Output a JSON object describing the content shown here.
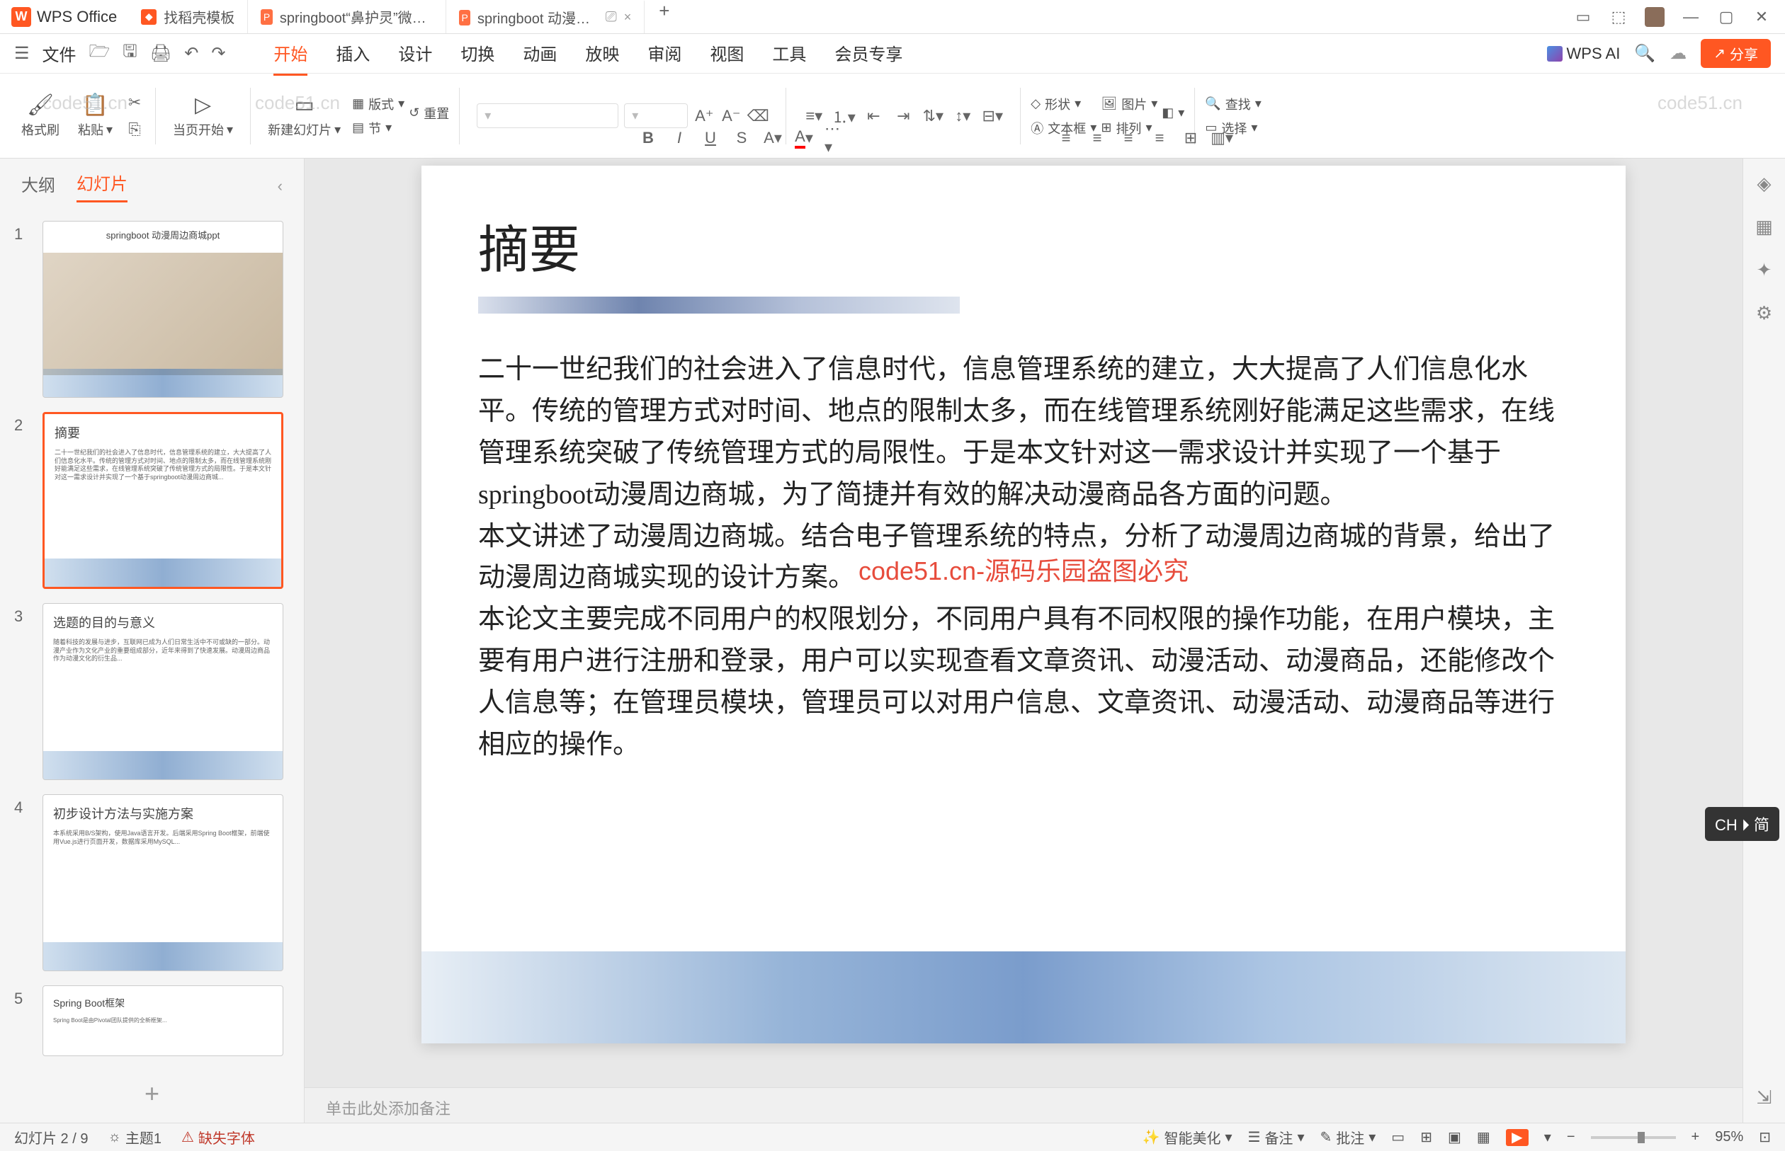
{
  "app_name": "WPS Office",
  "tabs": [
    {
      "icon": "red",
      "label": "找稻壳模板"
    },
    {
      "icon": "orange",
      "label": "springboot“鼻护灵”微信小程序的"
    },
    {
      "icon": "orange",
      "label": "springboot 动漫周边商城的",
      "active": true
    }
  ],
  "file_menu": "文件",
  "menu_tabs": [
    "开始",
    "插入",
    "设计",
    "切换",
    "动画",
    "放映",
    "审阅",
    "视图",
    "工具",
    "会员专享"
  ],
  "active_menu_tab": "开始",
  "wps_ai_label": "WPS AI",
  "share_label": "分享",
  "ribbon": {
    "format_brush": "格式刷",
    "paste": "粘贴",
    "from_current": "当页开始",
    "new_slide": "新建幻灯片",
    "layout": "版式",
    "section": "节",
    "reset": "重置",
    "shape": "形状",
    "textbox": "文本框",
    "image": "图片",
    "arrange": "排列",
    "find": "查找",
    "select": "选择"
  },
  "sidebar": {
    "outline_tab": "大纲",
    "slides_tab": "幻灯片",
    "thumbs": [
      {
        "num": "1",
        "title": "springboot 动漫周边商城ppt"
      },
      {
        "num": "2",
        "title": "摘要",
        "active": true
      },
      {
        "num": "3",
        "title": "选题的目的与意义"
      },
      {
        "num": "4",
        "title": "初步设计方法与实施方案"
      },
      {
        "num": "5",
        "title": "Spring Boot框架"
      }
    ]
  },
  "slide": {
    "title": "摘要",
    "body": "二十一世纪我们的社会进入了信息时代，信息管理系统的建立，大大提高了人们信息化水平。传统的管理方式对时间、地点的限制太多，而在线管理系统刚好能满足这些需求，在线管理系统突破了传统管理方式的局限性。于是本文针对这一需求设计并实现了一个基于springboot动漫周边商城，为了简捷并有效的解决动漫商品各方面的问题。\n本文讲述了动漫周边商城。结合电子管理系统的特点，分析了动漫周边商城的背景，给出了动漫周边商城实现的设计方案。\n本论文主要完成不同用户的权限划分，不同用户具有不同权限的操作功能，在用户模块，主要有用户进行注册和登录，用户可以实现查看文章资讯、动漫活动、动漫商品，还能修改个人信息等；在管理员模块，管理员可以对用户信息、文章资讯、动漫活动、动漫商品等进行相应的操作。",
    "watermark_red": "code51.cn-源码乐园盗图必究"
  },
  "notes_placeholder": "单击此处添加备注",
  "status": {
    "slide_counter": "幻灯片 2 / 9",
    "theme": "主题1",
    "missing_font": "缺失字体",
    "beautify": "智能美化",
    "notes": "备注",
    "comments": "批注",
    "zoom": "95%"
  },
  "ime": "CH ⏵ 简",
  "bg_watermark": "code51.cn"
}
